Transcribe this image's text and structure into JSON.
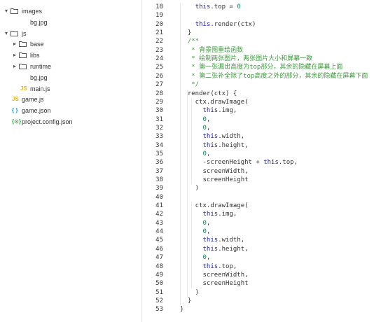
{
  "explorer": {
    "items": [
      {
        "label": "images",
        "type": "folder",
        "open": true,
        "depth": 0
      },
      {
        "label": "bg.jpg",
        "type": "image",
        "depth": 1
      },
      {
        "label": "js",
        "type": "folder",
        "open": true,
        "depth": 0
      },
      {
        "label": "base",
        "type": "folder",
        "open": false,
        "depth": 1
      },
      {
        "label": "libs",
        "type": "folder",
        "open": false,
        "depth": 1
      },
      {
        "label": "runtime",
        "type": "folder",
        "open": false,
        "depth": 1
      },
      {
        "label": "bg.jpg",
        "type": "image",
        "depth": 1
      },
      {
        "label": "main.js",
        "type": "js",
        "depth": 1
      },
      {
        "label": "game.js",
        "type": "js",
        "depth": 0
      },
      {
        "label": "game.json",
        "type": "json",
        "depth": 0
      },
      {
        "label": "project.config.json",
        "type": "config",
        "depth": 0
      }
    ]
  },
  "editor": {
    "lines": [
      {
        "n": "18",
        "text": "    this.top = 0"
      },
      {
        "n": "19",
        "text": ""
      },
      {
        "n": "20",
        "text": "    this.render(ctx)"
      },
      {
        "n": "21",
        "text": "  }"
      },
      {
        "n": "22",
        "text": "  /**"
      },
      {
        "n": "23",
        "text": "   * 背景图重绘函数"
      },
      {
        "n": "24",
        "text": "   * 绘制两张图片，两张图片大小和屏幕一致"
      },
      {
        "n": "25",
        "text": "   * 第一张漏出高度为top部分，其余的隐藏在屏幕上面"
      },
      {
        "n": "26",
        "text": "   * 第二张补全除了top高度之外的部分，其余的隐藏在屏幕下面"
      },
      {
        "n": "27",
        "text": "   */"
      },
      {
        "n": "28",
        "text": "  render(ctx) {"
      },
      {
        "n": "29",
        "text": "    ctx.drawImage("
      },
      {
        "n": "30",
        "text": "      this.img,"
      },
      {
        "n": "31",
        "text": "      0,"
      },
      {
        "n": "32",
        "text": "      0,"
      },
      {
        "n": "33",
        "text": "      this.width,"
      },
      {
        "n": "34",
        "text": "      this.height,"
      },
      {
        "n": "35",
        "text": "      0,"
      },
      {
        "n": "36",
        "text": "      -screenHeight + this.top,"
      },
      {
        "n": "37",
        "text": "      screenWidth,"
      },
      {
        "n": "38",
        "text": "      screenHeight"
      },
      {
        "n": "39",
        "text": "    )"
      },
      {
        "n": "40",
        "text": ""
      },
      {
        "n": "41",
        "text": "    ctx.drawImage("
      },
      {
        "n": "42",
        "text": "      this.img,"
      },
      {
        "n": "43",
        "text": "      0,"
      },
      {
        "n": "44",
        "text": "      0,"
      },
      {
        "n": "45",
        "text": "      this.width,"
      },
      {
        "n": "46",
        "text": "      this.height,"
      },
      {
        "n": "47",
        "text": "      0,"
      },
      {
        "n": "48",
        "text": "      this.top,"
      },
      {
        "n": "49",
        "text": "      screenWidth,"
      },
      {
        "n": "50",
        "text": "      screenHeight"
      },
      {
        "n": "51",
        "text": "    )"
      },
      {
        "n": "52",
        "text": "  }"
      },
      {
        "n": "53",
        "text": "}"
      }
    ]
  },
  "colors": {
    "keyword": "#1a1aa6",
    "comment": "#3f9a3f",
    "number": "#098658",
    "js_icon": "#e6b422",
    "json_icon": "#2b9be0",
    "config_icon": "#3cae4f"
  }
}
